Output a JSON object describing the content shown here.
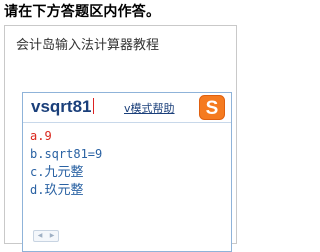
{
  "instruction": "请在下方答题区内作答。",
  "answer_area": {
    "text": "会计岛输入法计算器教程"
  },
  "ime": {
    "composition": "vsqrt81",
    "help_link": "v模式帮助",
    "logo": "sogou-logo-icon",
    "accent_color": "#d9261c",
    "candidates": [
      {
        "key": "a.",
        "text": "9"
      },
      {
        "key": "b.",
        "text": "sqrt81=9"
      },
      {
        "key": "c.",
        "text": "九元整"
      },
      {
        "key": "d.",
        "text": "玖元整"
      }
    ],
    "selected_index": 0,
    "pager": {
      "prev": "◀",
      "next": "▶"
    }
  }
}
